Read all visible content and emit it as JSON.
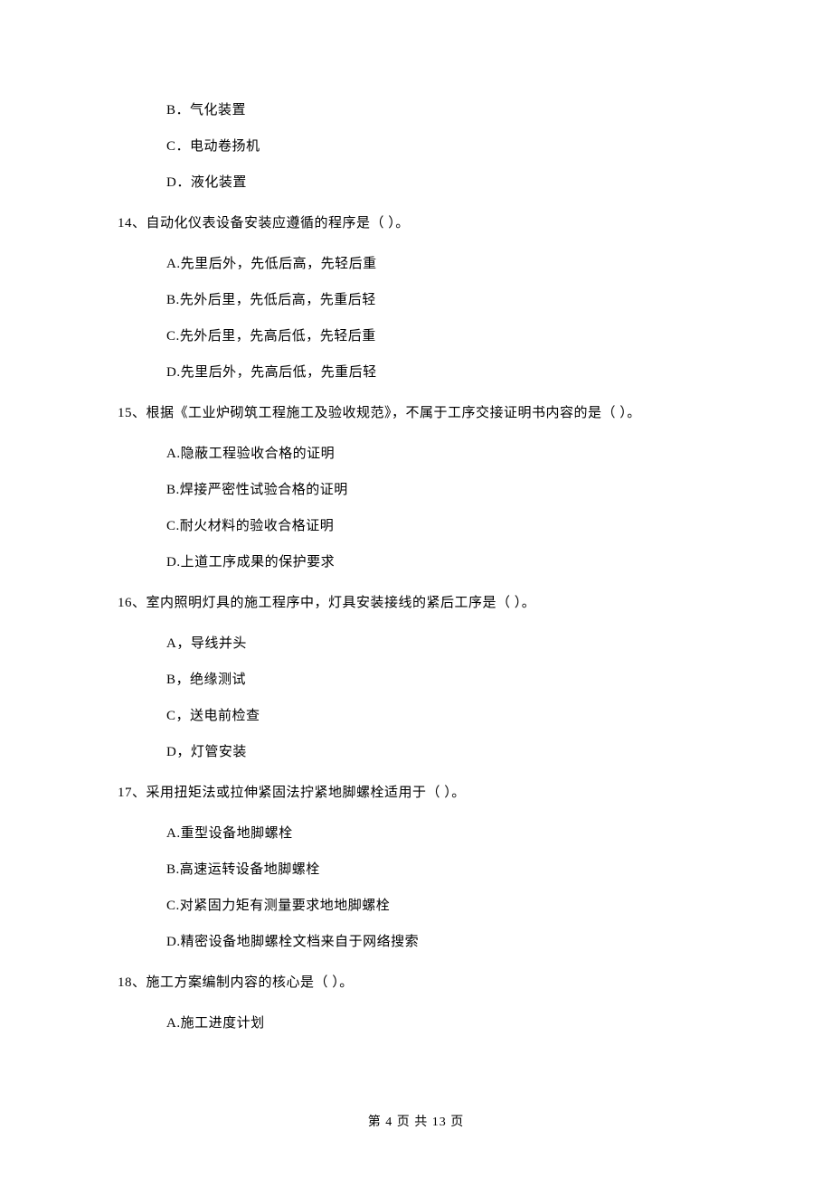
{
  "prelim_options": {
    "b": "B．气化装置",
    "c": "C．电动卷扬机",
    "d": "D．液化装置"
  },
  "q14": {
    "text": "14、自动化仪表设备安装应遵循的程序是（    ）。",
    "a": "A.先里后外，先低后高，先轻后重",
    "b": "B.先外后里，先低后高，先重后轻",
    "c": "C.先外后里，先高后低，先轻后重",
    "d": "D.先里后外，先高后低，先重后轻"
  },
  "q15": {
    "text": "15、根据《工业炉砌筑工程施工及验收规范》，不属于工序交接证明书内容的是（    ）。",
    "a": "A.隐蔽工程验收合格的证明",
    "b": "B.焊接严密性试验合格的证明",
    "c": "C.耐火材料的验收合格证明",
    "d": "D.上道工序成果的保护要求"
  },
  "q16": {
    "text": "16、室内照明灯具的施工程序中，灯具安装接线的紧后工序是（    ）。",
    "a": "A，导线并头",
    "b": "B，绝缘测试",
    "c": "C，送电前检查",
    "d": "D，灯管安装"
  },
  "q17": {
    "text": "17、采用扭矩法或拉伸紧固法拧紧地脚螺栓适用于（    ）。",
    "a": "A.重型设备地脚螺栓",
    "b": "B.高速运转设备地脚螺栓",
    "c": "C.对紧固力矩有测量要求地地脚螺栓",
    "d": "D.精密设备地脚螺栓文档来自于网络搜索"
  },
  "q18": {
    "text": "18、施工方案编制内容的核心是（    ）。",
    "a": "A.施工进度计划"
  },
  "footer": "第 4 页 共 13 页"
}
